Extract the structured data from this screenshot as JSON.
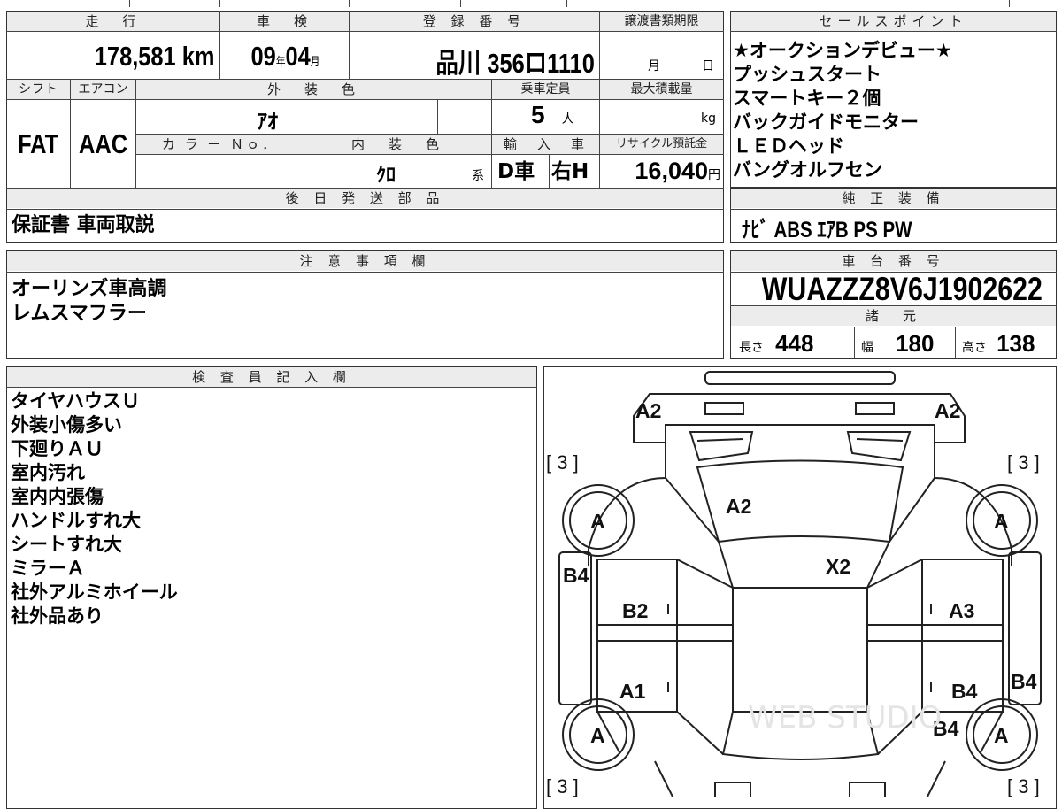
{
  "header": {
    "mileage_label": "走　行",
    "mileage_value": "178,581",
    "mileage_unit": "km",
    "inspection_label": "車　検",
    "inspection_year": "09",
    "inspection_year_unit": "年",
    "inspection_month": "04",
    "inspection_month_unit": "月",
    "registration_label": "登 録 番 号",
    "registration_area": "品川",
    "registration_number": "356ロ1110",
    "transfer_label": "譲渡書類期限",
    "transfer_month_unit": "月",
    "transfer_day_unit": "日"
  },
  "specs": {
    "shift_label": "シフト",
    "shift_value": "FAT",
    "aircon_label": "エアコン",
    "aircon_value": "AAC",
    "exterior_color_label": "外　装　色",
    "exterior_color_value": "ｱｵ",
    "capacity_label": "乗車定員",
    "capacity_value": "5",
    "capacity_unit": "人",
    "max_load_label": "最大積載量",
    "max_load_unit": "kg",
    "color_no_label": "カ ラ ー Ｎｏ．",
    "interior_color_label": "内　装　色",
    "interior_color_value": "ｸﾛ",
    "interior_color_suffix": "系",
    "import_label": "輸　入　車",
    "import_value": "D車",
    "steering_value": "右H",
    "recycle_label": "リサイクル預託金",
    "recycle_value": "16,040",
    "recycle_unit": "円"
  },
  "sales_points": {
    "label": "セールスポイント",
    "items": [
      "★オークションデビュー★",
      "プッシュスタート",
      "スマートキー２個",
      "バックガイドモニター",
      "ＬＥＤヘッド",
      "バングオルフセン"
    ]
  },
  "later_parts": {
    "label": "後 日 発 送 部 品",
    "value": "保証書 車両取説"
  },
  "equipment": {
    "label": "純 正 装 備",
    "value": "ﾅﾋﾞ ABS ｴｱB PS PW"
  },
  "notes": {
    "label": "注 意 事 項 欄",
    "items": [
      "オーリンズ車高調",
      "レムスマフラー"
    ]
  },
  "chassis": {
    "label": "車 台 番 号",
    "value": "WUAZZZ8V6J1902622"
  },
  "dimensions": {
    "label": "諸　元",
    "length_label": "長さ",
    "length_value": "448",
    "width_label": "幅",
    "width_value": "180",
    "height_label": "高さ",
    "height_value": "138"
  },
  "inspector": {
    "label": "検 査 員 記 入 欄",
    "items": [
      "タイヤハウスＵ",
      "外装小傷多い",
      "下廻りＡＵ",
      "室内汚れ",
      "室内内張傷",
      "ハンドルすれ大",
      "シートすれ大",
      "ミラーＡ",
      "社外アルミホイール",
      "社外品あり"
    ]
  },
  "diagram": {
    "marks": {
      "a2_top_left": "A2",
      "a2_top_right": "A2",
      "tread_top_left": "[ 3 ]",
      "tread_top_right": "[ 3 ]",
      "tread_bottom_left": "[ 3 ]",
      "tread_bottom_right": "[ 3 ]",
      "wheel_front_left": "A",
      "wheel_front_right": "A",
      "wheel_rear_left": "A",
      "wheel_rear_right": "A",
      "windshield": "A2",
      "roof": "X2",
      "b4_left_front": "B4",
      "b2_front_left_door": "B2",
      "a3_front_right_door": "A3",
      "a1_rear_left_door": "A1",
      "b4_rear_right_door": "B4",
      "b4_right_side": "B4",
      "b4_rear_right_corner": "B4"
    },
    "watermark": "WEB STUDIO"
  }
}
